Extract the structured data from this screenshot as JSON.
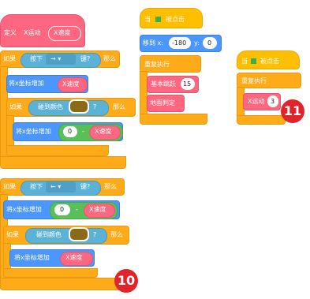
{
  "script_left": {
    "define_label": "定义",
    "define_name": "X运动",
    "define_param": "X速度",
    "if1_label": "如果",
    "key_pressed_label": "按下",
    "key1_value": "→ ▾",
    "key_suffix": "键?",
    "then_label": "那么",
    "change_x_label": "将x坐标增加",
    "param_xspeed": "X速度",
    "touching_color_label": "碰到颜色",
    "question_mark": "?",
    "zero_value": "0",
    "minus": "-",
    "key2_value": "← ▾",
    "badge": "10"
  },
  "script_main": {
    "when_flag_label": "当",
    "clicked_label": "被点击",
    "goto_label": "移到 x:",
    "goto_x": "-180",
    "goto_y_label": "y:",
    "goto_y": "0",
    "forever_label": "重复执行",
    "gravity_label": "基本跳跃",
    "gravity_value": "15",
    "ground_check_label": "地面判定"
  },
  "script_right": {
    "when_flag_label": "当",
    "clicked_label": "被点击",
    "forever_label": "重复执行",
    "x_move_label": "X运动",
    "x_move_value": "3",
    "badge": "11"
  }
}
